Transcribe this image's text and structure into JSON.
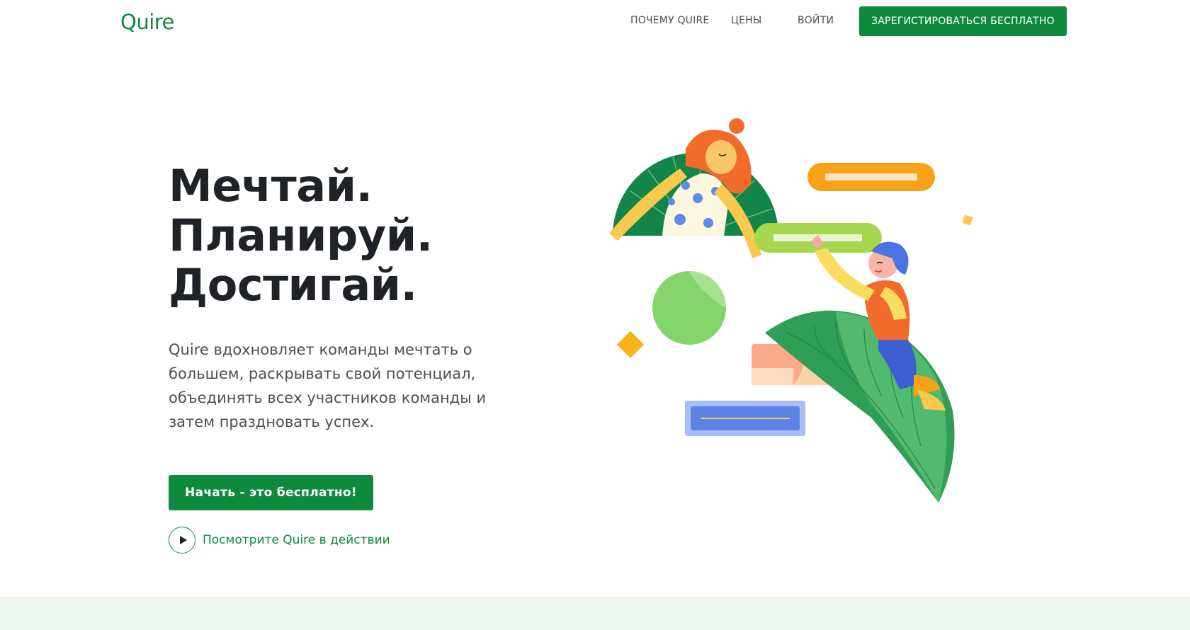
{
  "header": {
    "logo": "Quire",
    "nav": {
      "why": "ПОЧЕМУ QUIRE",
      "pricing": "ЦЕНЫ",
      "login": "ВОЙТИ"
    },
    "signup_label": "ЗАРЕГИСТИРОВАТЬСЯ БЕСПЛАТНО"
  },
  "hero": {
    "headline": [
      "Мечтай.",
      "Планируй.",
      "Достигай."
    ],
    "description": "Quire вдохновляет команды мечтать о большем, раскрывать свой потенциал, объединять всех участников команды и затем праздновать успех.",
    "cta_label": "Начать - это бесплатно!",
    "watch_label": "Посмотрите Quire в действии"
  },
  "colors": {
    "brand_green": "#0e8a3f",
    "headline": "#1f2328",
    "body_text": "#4a4f55",
    "footer_band": "#eef5ee"
  },
  "icons": {
    "play": "play-icon"
  }
}
